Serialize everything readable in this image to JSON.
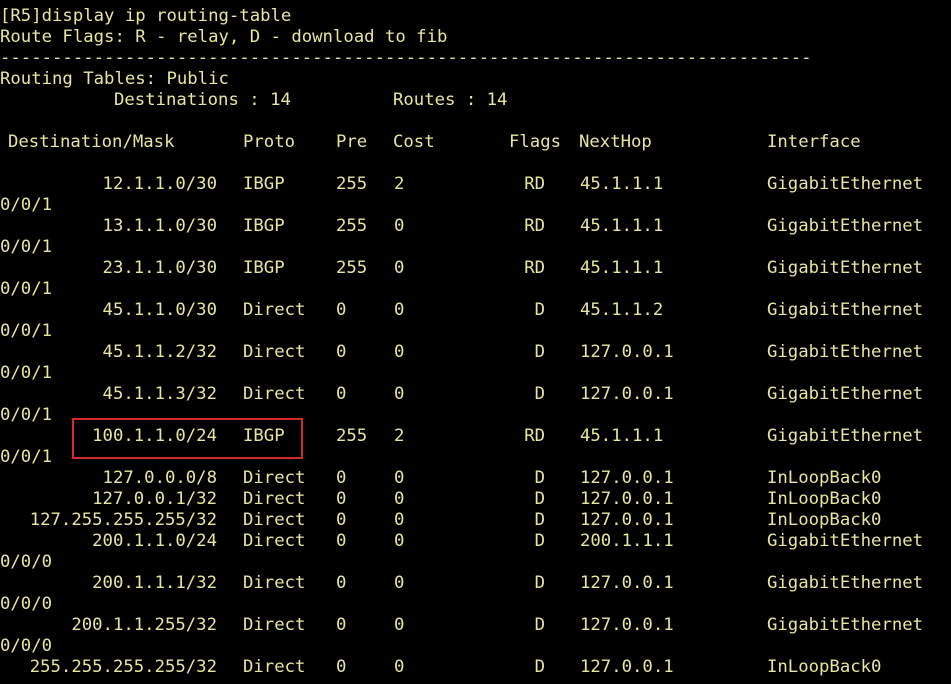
{
  "terminal": {
    "command_line": "[R5]display ip routing-table",
    "flags_legend": "Route Flags: R - relay, D - download to fib",
    "separator": "------------------------------------------------------------------------------",
    "table_title": "Routing Tables: Public",
    "destinations_label": "Destinations : 14",
    "routes_label": "Routes : 14",
    "headers": {
      "destination": "Destination/Mask",
      "proto": "Proto",
      "pre": "Pre",
      "cost": "Cost",
      "flags": "Flags",
      "nexthop": "NextHop",
      "interface": "Interface"
    },
    "routes": [
      {
        "dest": "12.1.1.0/30",
        "proto": "IBGP",
        "pre": "255",
        "cost": "2",
        "flags": "RD",
        "nexthop": "45.1.1.1",
        "iface": "GigabitEthernet",
        "iface_cont": "0/0/1"
      },
      {
        "dest": "13.1.1.0/30",
        "proto": "IBGP",
        "pre": "255",
        "cost": "0",
        "flags": "RD",
        "nexthop": "45.1.1.1",
        "iface": "GigabitEthernet",
        "iface_cont": "0/0/1"
      },
      {
        "dest": "23.1.1.0/30",
        "proto": "IBGP",
        "pre": "255",
        "cost": "0",
        "flags": "RD",
        "nexthop": "45.1.1.1",
        "iface": "GigabitEthernet",
        "iface_cont": "0/0/1"
      },
      {
        "dest": "45.1.1.0/30",
        "proto": "Direct",
        "pre": "0",
        "cost": "0",
        "flags": "D",
        "nexthop": "45.1.1.2",
        "iface": "GigabitEthernet",
        "iface_cont": "0/0/1"
      },
      {
        "dest": "45.1.1.2/32",
        "proto": "Direct",
        "pre": "0",
        "cost": "0",
        "flags": "D",
        "nexthop": "127.0.0.1",
        "iface": "GigabitEthernet",
        "iface_cont": "0/0/1"
      },
      {
        "dest": "45.1.1.3/32",
        "proto": "Direct",
        "pre": "0",
        "cost": "0",
        "flags": "D",
        "nexthop": "127.0.0.1",
        "iface": "GigabitEthernet",
        "iface_cont": "0/0/1"
      },
      {
        "dest": "100.1.1.0/24",
        "proto": "IBGP",
        "pre": "255",
        "cost": "2",
        "flags": "RD",
        "nexthop": "45.1.1.1",
        "iface": "GigabitEthernet",
        "iface_cont": "0/0/1"
      },
      {
        "dest": "127.0.0.0/8",
        "proto": "Direct",
        "pre": "0",
        "cost": "0",
        "flags": "D",
        "nexthop": "127.0.0.1",
        "iface": "InLoopBack0",
        "iface_cont": ""
      },
      {
        "dest": "127.0.0.1/32",
        "proto": "Direct",
        "pre": "0",
        "cost": "0",
        "flags": "D",
        "nexthop": "127.0.0.1",
        "iface": "InLoopBack0",
        "iface_cont": ""
      },
      {
        "dest": "127.255.255.255/32",
        "proto": "Direct",
        "pre": "0",
        "cost": "0",
        "flags": "D",
        "nexthop": "127.0.0.1",
        "iface": "InLoopBack0",
        "iface_cont": ""
      },
      {
        "dest": "200.1.1.0/24",
        "proto": "Direct",
        "pre": "0",
        "cost": "0",
        "flags": "D",
        "nexthop": "200.1.1.1",
        "iface": "GigabitEthernet",
        "iface_cont": "0/0/0"
      },
      {
        "dest": "200.1.1.1/32",
        "proto": "Direct",
        "pre": "0",
        "cost": "0",
        "flags": "D",
        "nexthop": "127.0.0.1",
        "iface": "GigabitEthernet",
        "iface_cont": "0/0/0"
      },
      {
        "dest": "200.1.1.255/32",
        "proto": "Direct",
        "pre": "0",
        "cost": "0",
        "flags": "D",
        "nexthop": "127.0.0.1",
        "iface": "GigabitEthernet",
        "iface_cont": "0/0/0"
      },
      {
        "dest": "255.255.255.255/32",
        "proto": "Direct",
        "pre": "0",
        "cost": "0",
        "flags": "D",
        "nexthop": "127.0.0.1",
        "iface": "InLoopBack0",
        "iface_cont": ""
      }
    ]
  },
  "colors": {
    "background": "#000000",
    "text": "#e6e6a0",
    "highlight": "#d42a2a"
  }
}
